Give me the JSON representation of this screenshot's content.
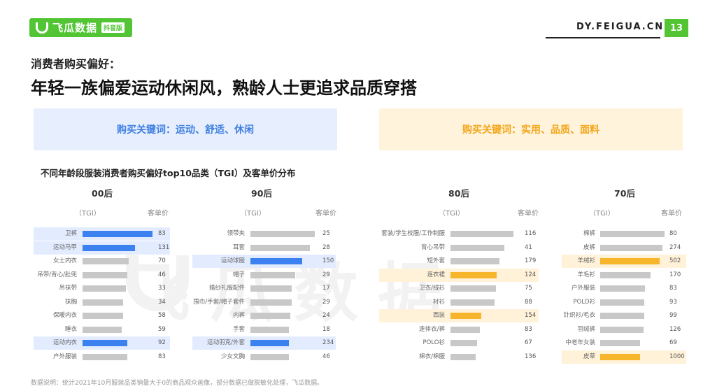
{
  "header": {
    "brand": "飞瓜数据",
    "brand_badge": "抖音版",
    "site": "DY.FEIGUA.CN",
    "page_number": "13"
  },
  "title": {
    "line1": "消费者购买偏好：",
    "line2": "年轻一族偏爱运动休闲风，熟龄人士更追求品质穿搭"
  },
  "keywords": {
    "left": "购买关键词：运动、舒适、休闲",
    "right": "购买关键词：实用、品质、面料"
  },
  "colors": {
    "brand": "#53c534",
    "blue": "#3b82f0",
    "orange": "#f6b52a",
    "gray_bar": "#c8c8c8"
  },
  "watermark": "飞瓜数据",
  "chart_data": {
    "type": "bar",
    "title": "不同年龄段服装消费者购买偏好top10品类（TGI）及客单价分布",
    "column_headers": {
      "tgi": "（TGI）",
      "price": "客单价"
    },
    "groups": [
      {
        "name": "00后",
        "highlight": "blue",
        "categories": [
          "卫裤",
          "运动马甲",
          "女士内衣",
          "吊带/背心/肚兜",
          "吊袜带",
          "抹胸",
          "保暖内衣",
          "睡衣",
          "运动内衣",
          "户外服装"
        ],
        "tgi_relative": [
          1.0,
          0.75,
          0.66,
          0.64,
          0.62,
          0.58,
          0.58,
          0.56,
          0.64,
          0.64
        ],
        "price": [
          83,
          131,
          70,
          46,
          33,
          34,
          58,
          59,
          92,
          83
        ],
        "highlighted": [
          true,
          true,
          false,
          false,
          false,
          false,
          false,
          false,
          true,
          false
        ]
      },
      {
        "name": "90后",
        "highlight": "blue",
        "categories": [
          "领带夹",
          "耳套",
          "运动球服",
          "帽子",
          "婚纱礼服配件",
          "围巾/手套/帽子套件",
          "内裤",
          "手套",
          "运动羽克/外套",
          "少女文胸"
        ],
        "tgi_relative": [
          1.0,
          0.92,
          0.8,
          0.7,
          0.64,
          0.64,
          0.62,
          0.6,
          0.6,
          0.6
        ],
        "price": [
          25,
          28,
          150,
          29,
          17,
          29,
          24,
          18,
          234,
          46
        ],
        "highlighted": [
          false,
          false,
          true,
          false,
          false,
          false,
          false,
          false,
          true,
          false
        ]
      },
      {
        "name": "80后",
        "highlight": "orange",
        "categories": [
          "套装/学生校服/工作制服",
          "背心吊带",
          "短外套",
          "连衣裙",
          "卫衣/绒衫",
          "衬衫",
          "西装",
          "连体衣/裤",
          "POLO衫",
          "棉衣/棉服"
        ],
        "tgi_relative": [
          1.0,
          0.86,
          0.78,
          0.73,
          0.72,
          0.7,
          0.49,
          0.47,
          0.42,
          0.4
        ],
        "price": [
          116,
          41,
          179,
          124,
          75,
          88,
          154,
          83,
          67,
          136
        ],
        "highlighted": [
          false,
          false,
          false,
          true,
          false,
          false,
          true,
          false,
          false,
          false
        ]
      },
      {
        "name": "70后",
        "highlight": "orange",
        "categories": [
          "棉裤",
          "皮裤",
          "羊绒衫",
          "羊毛衫",
          "户外服装",
          "POLO衫",
          "针织衫/毛衣",
          "羽绒裤",
          "中老年女装",
          "皮草"
        ],
        "tgi_relative": [
          1.0,
          0.97,
          0.92,
          0.78,
          0.7,
          0.69,
          0.68,
          0.67,
          0.62,
          0.62
        ],
        "price": [
          80,
          274,
          502,
          170,
          83,
          93,
          99,
          126,
          69,
          1000
        ],
        "highlighted": [
          false,
          false,
          true,
          false,
          false,
          false,
          false,
          false,
          false,
          true
        ]
      }
    ]
  },
  "footnote": "数据说明：统计2021年10月服装品类销量大于0的商品观众画像，部分数据已做脱敏化处理，飞瓜数据。"
}
